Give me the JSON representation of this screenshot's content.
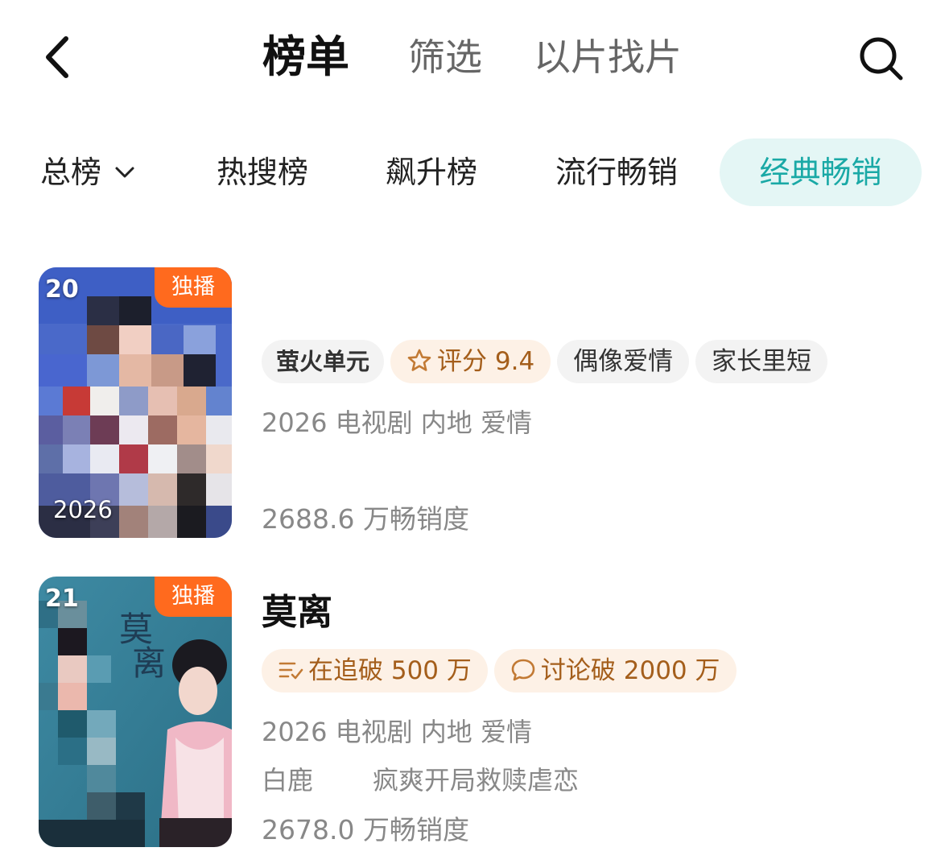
{
  "header": {
    "tabs": [
      "榜单",
      "筛选",
      "以片找片"
    ]
  },
  "chips": [
    "总榜",
    "热搜榜",
    "飙升榜",
    "流行畅销",
    "经典畅销"
  ],
  "colors": {
    "accent": "#1aa9a6",
    "exclusive": "#ff6a1e",
    "warm_tag_text": "#a45e1b"
  },
  "items": [
    {
      "rank": "20",
      "badge": "独播",
      "poster_year": "2026",
      "title": "",
      "tags": [
        "萤火单元",
        "评分 9.4",
        "偶像爱情",
        "家长里短"
      ],
      "meta": "2026 电视剧 内地 爱情",
      "sales": "2688.6 万畅销度"
    },
    {
      "rank": "21",
      "badge": "独播",
      "title": "莫离",
      "tags": [
        "在追破 500 万",
        "讨论破 2000 万"
      ],
      "meta": "2026 电视剧 内地 爱情",
      "cast": "白鹿",
      "blurb": "疯爽开局救赎虐恋",
      "sales": "2678.0 万畅销度"
    }
  ]
}
